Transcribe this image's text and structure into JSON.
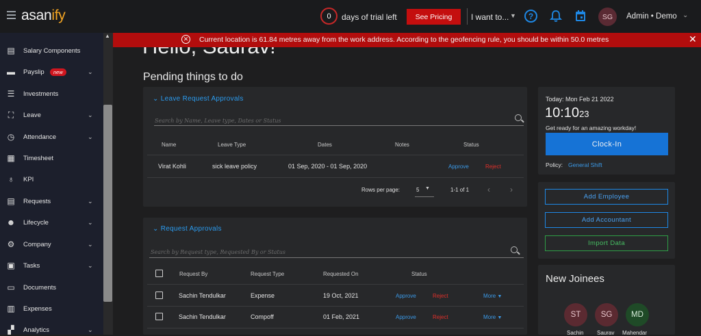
{
  "topbar": {
    "logo_main": "asan",
    "logo_accent": "ify",
    "trial_days": "0",
    "trial_text": "days of trial left",
    "pricing_label": "See Pricing",
    "want_to_label": "I want to...",
    "user_initials": "SG",
    "user_name": "Admin • Demo"
  },
  "sidebar": {
    "items": [
      {
        "label": "Salary Components",
        "icon": "salary-icon"
      },
      {
        "label": "Payslip",
        "icon": "payslip-icon",
        "badge": "new"
      },
      {
        "label": "Investments",
        "icon": "investments-icon"
      },
      {
        "label": "Leave",
        "icon": "leave-icon"
      },
      {
        "label": "Attendance",
        "icon": "attendance-icon"
      },
      {
        "label": "Timesheet",
        "icon": "timesheet-icon"
      },
      {
        "label": "KPI",
        "icon": "kpi-icon"
      },
      {
        "label": "Requests",
        "icon": "requests-icon"
      },
      {
        "label": "Lifecycle",
        "icon": "lifecycle-icon"
      },
      {
        "label": "Company",
        "icon": "company-icon"
      },
      {
        "label": "Tasks",
        "icon": "tasks-icon"
      },
      {
        "label": "Documents",
        "icon": "documents-icon"
      },
      {
        "label": "Expenses",
        "icon": "expenses-icon"
      },
      {
        "label": "Analytics",
        "icon": "analytics-icon"
      }
    ]
  },
  "alert": {
    "text": "Current location is 61.84 metres away from the work address. According to the geofencing rule, you should be within 50.0 metres"
  },
  "main": {
    "greeting": "Hello, Saurav!",
    "pending_title": "Pending things to do",
    "leave_section": {
      "title": "Leave Request Approvals",
      "search_placeholder": "Search by Name, Leave type, Dates or Status",
      "headers": [
        "Name",
        "Leave Type",
        "Dates",
        "Notes",
        "Status"
      ],
      "rows": [
        {
          "name": "Virat Kohli",
          "type": "sick leave policy",
          "dates": "01 Sep, 2020 - 01 Sep, 2020",
          "notes": "",
          "approve": "Approve",
          "reject": "Reject"
        }
      ],
      "rows_per_page_label": "Rows per page:",
      "rows_per_page": "5",
      "range": "1-1 of 1"
    },
    "request_section": {
      "title": "Request Approvals",
      "search_placeholder": "Search by Request type, Requested By or Status",
      "headers": [
        "Request By",
        "Request Type",
        "Requested On",
        "Status"
      ],
      "rows": [
        {
          "by": "Sachin Tendulkar",
          "type": "Expense",
          "on": "19 Oct, 2021",
          "approve": "Approve",
          "reject": "Reject",
          "more": "More"
        },
        {
          "by": "Sachin Tendulkar",
          "type": "Compoff",
          "on": "01 Feb, 2021",
          "approve": "Approve",
          "reject": "Reject",
          "more": "More"
        }
      ]
    }
  },
  "right": {
    "today_label": "Today: Mon Feb 21 2022",
    "time_main": "10:10",
    "time_sec": "23",
    "tagline": "Get ready for an amazing workday!",
    "clockin_label": "Clock-In",
    "policy_label": "Policy:",
    "policy_value": "General Shift",
    "add_employee": "Add Employee",
    "add_accountant": "Add Accountant",
    "import_data": "Import Data",
    "new_joinees_title": "New Joinees",
    "joinees": [
      {
        "initials": "ST",
        "name": "Sachin",
        "bg": "#5b2a31",
        "fg": "#e8c7cd"
      },
      {
        "initials": "SG",
        "name": "Saurav",
        "bg": "#5b2a31",
        "fg": "#e8c7cd"
      },
      {
        "initials": "MD",
        "name": "Mahendar",
        "bg": "#1f4a27",
        "fg": "#d5ead8"
      }
    ]
  },
  "colors": {
    "accent_blue": "#1e88e5",
    "alert_red": "#b20d0d",
    "green": "#2e9e46"
  }
}
